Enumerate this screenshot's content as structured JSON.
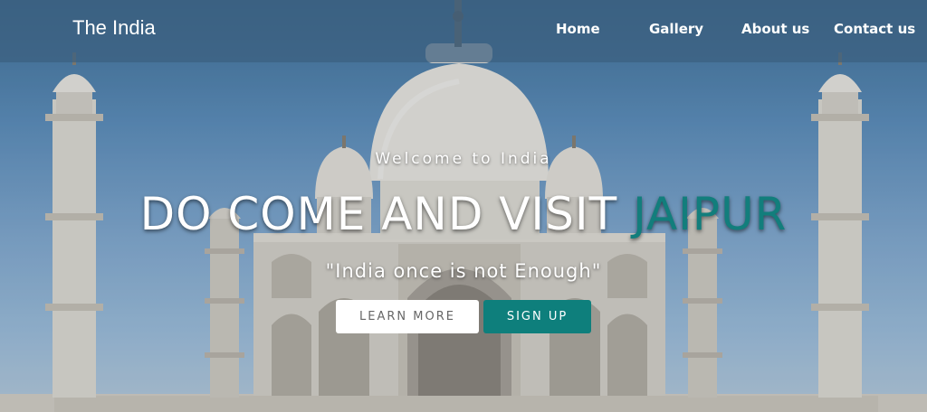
{
  "nav": {
    "brand": "The India",
    "links": [
      "Home",
      "Gallery",
      "About us",
      "Contact us"
    ]
  },
  "hero": {
    "tagline": "Welcome to India",
    "headline": "DO COME AND VISIT",
    "headline_accent": "JAIPUR",
    "quote": "\"India once is not Enough\"",
    "learn_more": "LEARN MORE",
    "sign_up": "SIGN UP",
    "background": "taj-mahal-photo"
  },
  "colors": {
    "accent": "#0e7f7c",
    "nav_bg": "#3c6080",
    "text": "#ffffff"
  }
}
